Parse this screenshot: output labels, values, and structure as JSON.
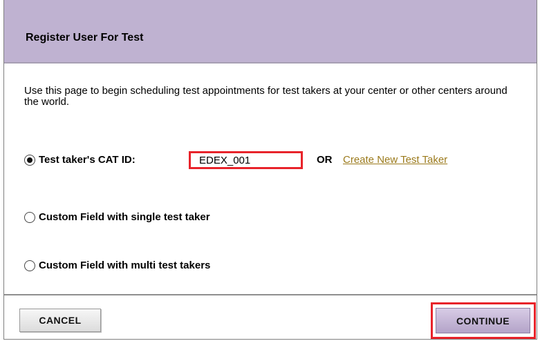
{
  "header": {
    "title": "Register User For Test"
  },
  "intro": {
    "text": "Use this page to begin scheduling test appointments for test takers at your center or other centers around the world."
  },
  "options": [
    {
      "label": "Test taker's CAT ID:",
      "selected": true
    },
    {
      "label": "Custom Field with single test taker",
      "selected": false
    },
    {
      "label": "Custom Field with multi test takers",
      "selected": false
    }
  ],
  "cat_id": {
    "value": "EDEX_001"
  },
  "or_label": "OR",
  "create_link": "Create New Test Taker",
  "buttons": {
    "cancel": "CANCEL",
    "continue": "CONTINUE"
  },
  "colors": {
    "header_bg": "#bfb2d1",
    "highlight": "#e8232a",
    "link": "#9b7a1c",
    "continue_bg": "#c5b8d8"
  }
}
